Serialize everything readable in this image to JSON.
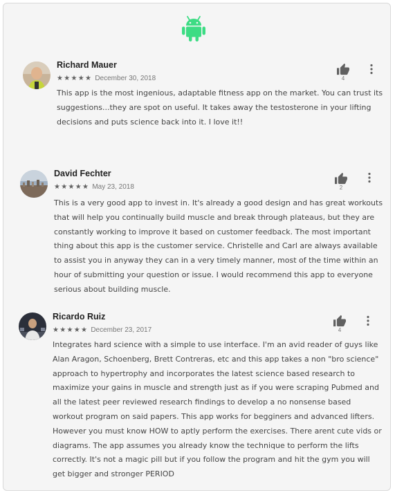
{
  "header": {
    "icon": "android-icon",
    "accent_color": "#3ddc84"
  },
  "reviews": [
    {
      "author": "Richard Mauer",
      "rating": 5,
      "stars": "★★★★★",
      "date": "December 30, 2018",
      "likes": "4",
      "text": "This app is the most ingenious, adaptable fitness app on the market. You can trust its suggestions...they are spot on useful. It takes away the testosterone in your lifting decisions and puts science back into it. I love it!!"
    },
    {
      "author": "David Fechter",
      "rating": 5,
      "stars": "★★★★★",
      "date": "May 23, 2018",
      "likes": "2",
      "text": "This is a very good app to invest in. It's already a good design and has great workouts that will help you continually build muscle and break through plateaus, but they are constantly working to improve it based on customer feedback. The most important thing about this app is the customer service. Christelle and Carl are always available to assist you in anyway they can in a very timely manner, most of the time within an hour of submitting your question or issue. I would recommend this app to everyone serious about building muscle."
    },
    {
      "author": "Ricardo Ruiz",
      "rating": 5,
      "stars": "★★★★★",
      "date": "December 23, 2017",
      "likes": "4",
      "text": "Integrates hard science with a simple to use interface. I'm an avid reader of guys like Alan Aragon, Schoenberg, Brett Contreras, etc and this app takes a non \"bro science\" approach to hypertrophy and incorporates the latest science based research to maximize your gains in muscle and strength just as if you were scraping Pubmed and all the latest peer reviewed research findings to develop a no nonsense based workout program on said papers. This app works for begginers and advanced lifters. However you must know HOW to aptly perform the exercises. There arent cute vids or diagrams. The app assumes you already know the technique to perform the lifts correctly. It's not a magic pill but if you follow the program and hit the gym you will get bigger and stronger PERIOD"
    }
  ]
}
